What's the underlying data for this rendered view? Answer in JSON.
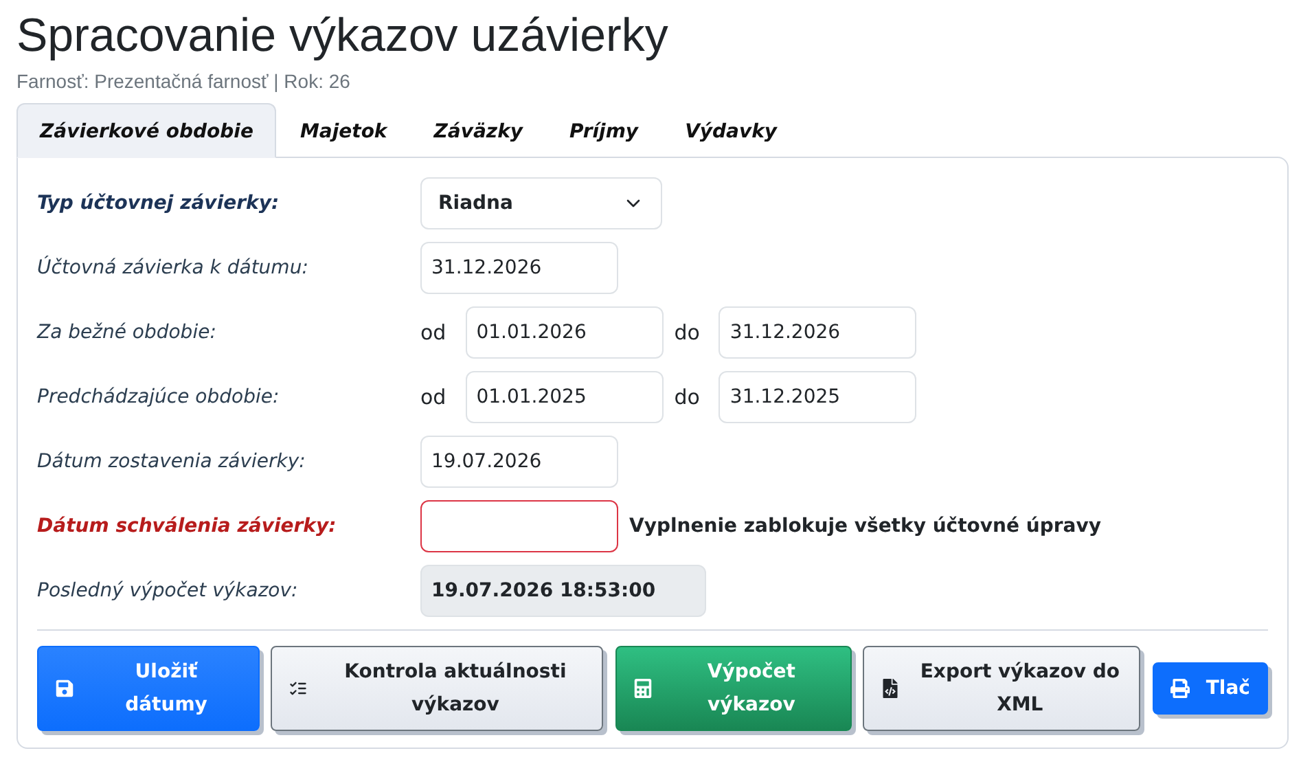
{
  "title": "Spracovanie výkazov uzávierky",
  "subtitle": "Farnosť: Prezentačná farnosť | Rok: 26",
  "tabs": [
    {
      "label": "Závierkové obdobie",
      "selected": true
    },
    {
      "label": "Majetok",
      "selected": false
    },
    {
      "label": "Záväzky",
      "selected": false
    },
    {
      "label": "Príjmy",
      "selected": false
    },
    {
      "label": "Výdavky",
      "selected": false
    }
  ],
  "form_rows": [
    {
      "kind": "select",
      "label": "Typ účtovnej závierky:",
      "value": "Riadna"
    },
    {
      "kind": "date",
      "label": "Účtovná závierka k dátumu:",
      "value": "31.12.2026"
    },
    {
      "kind": "range",
      "label": "Za bežné obdobie:",
      "from_label": "od",
      "from": "01.01.2026",
      "to_label": "do",
      "to": "31.12.2026"
    },
    {
      "kind": "range",
      "label": "Predchádzajúce obdobie:",
      "from_label": "od",
      "from": "01.01.2025",
      "to_label": "do",
      "to": "31.12.2025"
    },
    {
      "kind": "date",
      "label": "Dátum zostavenia závierky:",
      "value": "19.07.2026"
    },
    {
      "kind": "required",
      "label": "Dátum schválenia závierky:",
      "note": "Vyplnenie zablokuje všetky účtovné úpravy"
    },
    {
      "kind": "readonly",
      "label": "Posledný výpočet výkazov:",
      "value": "19.07.2026 18:53:00"
    }
  ],
  "buttons": [
    {
      "kind": "primary",
      "label": "Uložiť dátumy"
    },
    {
      "kind": "secondary",
      "label": "Kontrola aktuálnosti výkazov"
    },
    {
      "kind": "success",
      "label": "Výpočet výkazov"
    },
    {
      "kind": "secondary",
      "label": "Export výkazov do XML"
    },
    {
      "kind": "small",
      "label": "Tlač"
    }
  ]
}
